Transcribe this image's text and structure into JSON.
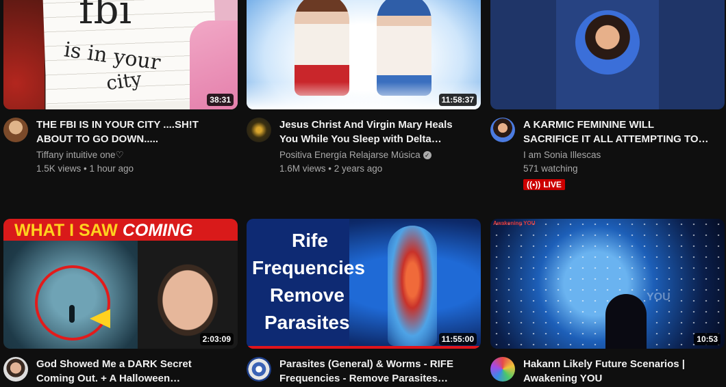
{
  "videos": [
    {
      "title": "THE FBI IS IN YOUR CITY ....SH!T\nABOUT TO GO DOWN.....",
      "channel": "Tiffany intuitive one♡",
      "stats": "1.5K views • 1 hour ago",
      "duration": "38:31",
      "thumb_text": [
        "fbi",
        "is in your",
        "city"
      ]
    },
    {
      "title": "Jesus Christ And Virgin Mary Heals\nYou While You Sleep with Delta…",
      "channel": "Positiva Energía Relajarse Música",
      "stats": "1.6M views • 2 years ago",
      "duration": "11:58:37",
      "verified": "✓"
    },
    {
      "title": "A KARMIC FEMININE WILL\nSACRIFICE IT ALL ATTEMPTING TO…",
      "channel": "I am Sonia Illescas",
      "stats": "571 watching",
      "live_label": "LIVE"
    },
    {
      "title": "God Showed Me a DARK Secret\nComing Out. + A Halloween…",
      "duration": "2:03:09",
      "thumb_text_a": "WHAT I SAW",
      "thumb_text_b": "COMING"
    },
    {
      "title": "Parasites (General) & Worms - RIFE\nFrequencies - Remove Parasites…",
      "duration": "11:55:00",
      "thumb_text": [
        "Rife",
        "Frequencies",
        "Remove",
        "Parasites"
      ]
    },
    {
      "title": "Hakann Likely Future Scenarios |\nAwakening YOU",
      "duration": "10:53",
      "thumb_corner": "Awakening YOU",
      "thumb_watermark": "YOU"
    }
  ]
}
